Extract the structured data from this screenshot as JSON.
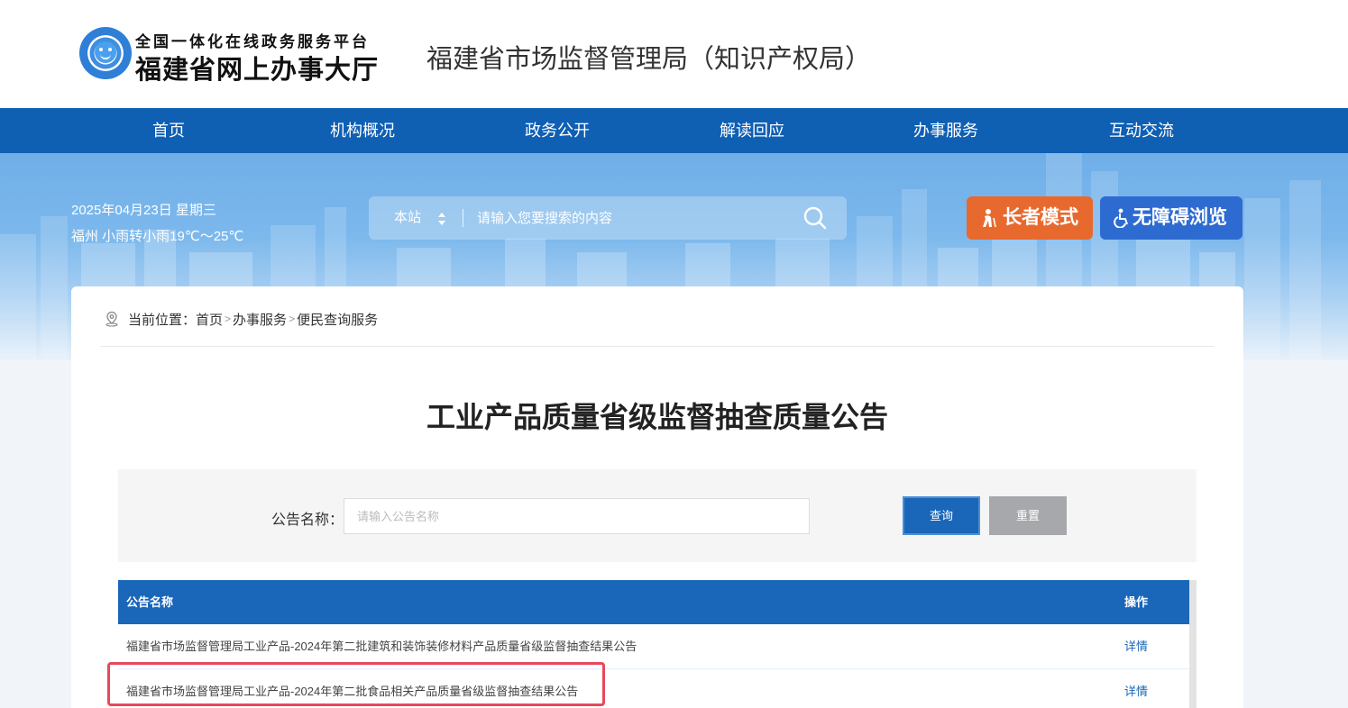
{
  "header": {
    "logo_line1": "全国一体化在线政务服务平台",
    "logo_line2": "福建省网上办事大厅",
    "site_title": "福建省市场监督管理局（知识产权局）"
  },
  "nav": {
    "items": [
      {
        "label": "首页"
      },
      {
        "label": "机构概况"
      },
      {
        "label": "政务公开"
      },
      {
        "label": "解读回应"
      },
      {
        "label": "办事服务"
      },
      {
        "label": "互动交流"
      }
    ]
  },
  "banner": {
    "date": "2025年04月23日 星期三",
    "weather": "福州 小雨转小雨19℃～25℃",
    "search_scope": "本站",
    "search_placeholder": "请输入您要搜索的内容",
    "elder_mode_label": "长者模式",
    "accessible_label": "无障碍浏览"
  },
  "breadcrumb": {
    "prefix": "当前位置：",
    "items": [
      "首页",
      "办事服务",
      "便民查询服务"
    ],
    "separator": ">"
  },
  "page_title": "工业产品质量省级监督抽查质量公告",
  "filter": {
    "label": "公告名称：",
    "placeholder": "请输入公告名称",
    "query_label": "查询",
    "reset_label": "重置"
  },
  "table": {
    "columns": [
      "公告名称",
      "操作"
    ],
    "rows": [
      {
        "name": "福建省市场监督管理局工业产品-2024年第二批建筑和装饰装修材料产品质量省级监督抽查结果公告",
        "action": "详情"
      },
      {
        "name": "福建省市场监督管理局工业产品-2024年第二批食品相关产品质量省级监督抽查结果公告",
        "action": "详情"
      }
    ]
  },
  "colors": {
    "nav_bg": "#0f5fb3",
    "elder_btn": "#e8692e",
    "access_btn": "#2e6bd1",
    "table_header": "#1a66b8",
    "highlight": "#e8485c"
  }
}
